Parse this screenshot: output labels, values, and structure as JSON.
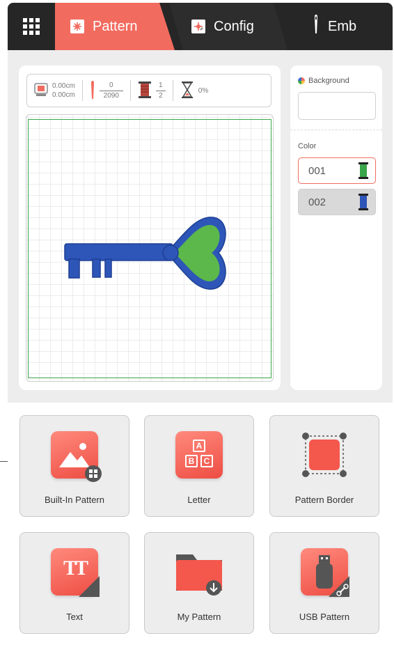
{
  "tabs": [
    {
      "label": "Pattern",
      "active": true
    },
    {
      "label": "Config",
      "active": false
    },
    {
      "label": "Emb",
      "active": false
    }
  ],
  "status": {
    "size_w": "0.00cm",
    "size_h": "0.00cm",
    "stitch_current": "0",
    "stitch_total": "2090",
    "color_current": "1",
    "color_total": "2",
    "progress": "0%"
  },
  "side": {
    "background_label": "Background",
    "color_label": "Color",
    "colors": [
      {
        "code": "001",
        "thread": "#3aa64a"
      },
      {
        "code": "002",
        "thread": "#2e56b8"
      }
    ]
  },
  "tiles": {
    "builtin": "Built-In Pattern",
    "letter": "Letter",
    "letter_glyphs": [
      "A",
      "B",
      "C"
    ],
    "border": "Pattern Border",
    "text": "Text",
    "text_glyph": "TT",
    "my_pattern": "My Pattern",
    "usb": "USB Pattern"
  },
  "colors": {
    "accent": "#f26b5f",
    "topbar": "#262626",
    "key_blue": "#2e56b8",
    "key_green": "#5cb84a"
  }
}
